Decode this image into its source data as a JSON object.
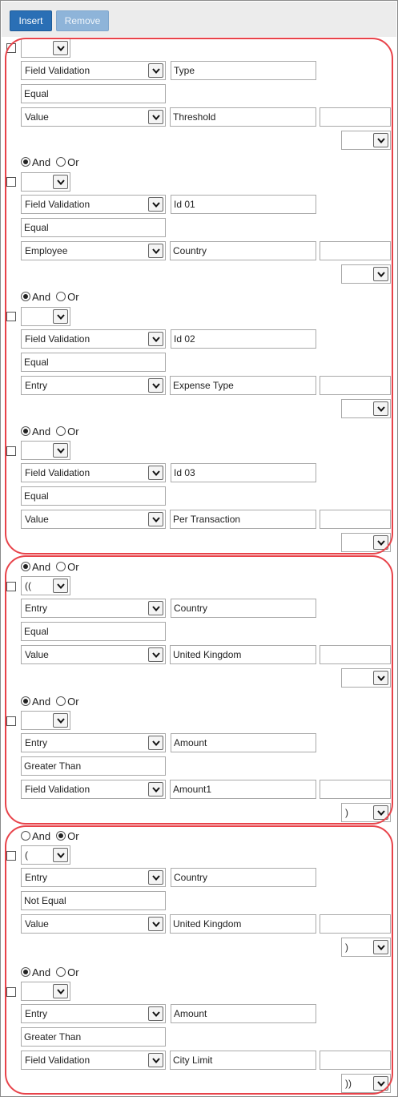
{
  "toolbar": {
    "insert_label": "Insert",
    "remove_label": "Remove"
  },
  "conditions": [
    {
      "show_andor": false,
      "andor": "",
      "paren_open": "",
      "source": "Field Validation",
      "field": "Type",
      "operator": "Equal",
      "value_source": "Value",
      "value": "Threshold",
      "value2": "",
      "paren_close": ""
    },
    {
      "show_andor": true,
      "andor": "And",
      "paren_open": "",
      "source": "Field Validation",
      "field": "Id 01",
      "operator": "Equal",
      "value_source": "Employee",
      "value": "Country",
      "value2": "",
      "paren_close": ""
    },
    {
      "show_andor": true,
      "andor": "And",
      "paren_open": "",
      "source": "Field Validation",
      "field": "Id 02",
      "operator": "Equal",
      "value_source": "Entry",
      "value": "Expense Type",
      "value2": "",
      "paren_close": ""
    },
    {
      "show_andor": true,
      "andor": "And",
      "paren_open": "",
      "source": "Field Validation",
      "field": "Id 03",
      "operator": "Equal",
      "value_source": "Value",
      "value": "Per Transaction",
      "value2": "",
      "paren_close": ""
    },
    {
      "show_andor": true,
      "andor": "And",
      "paren_open": "((",
      "source": "Entry",
      "field": "Country",
      "operator": "Equal",
      "value_source": "Value",
      "value": "United Kingdom",
      "value2": "",
      "paren_close": ""
    },
    {
      "show_andor": true,
      "andor": "And",
      "paren_open": "",
      "source": "Entry",
      "field": "Amount",
      "operator": "Greater Than",
      "value_source": "Field Validation",
      "value": "Amount1",
      "value2": "",
      "paren_close": ")"
    },
    {
      "show_andor": true,
      "andor": "Or",
      "paren_open": "(",
      "source": "Entry",
      "field": "Country",
      "operator": "Not Equal",
      "value_source": "Value",
      "value": "United Kingdom",
      "value2": "",
      "paren_close": ")"
    },
    {
      "show_andor": true,
      "andor": "And",
      "paren_open": "",
      "source": "Entry",
      "field": "Amount",
      "operator": "Greater Than",
      "value_source": "Field Validation",
      "value": "City Limit",
      "value2": "",
      "paren_close": "))"
    }
  ],
  "radio_labels": {
    "and": "And",
    "or": "Or"
  },
  "colors": {
    "group_border": "#e8434a",
    "insert_bg": "#2a6fb5",
    "remove_bg": "#8eb4d9"
  },
  "icons": {
    "dropdown": "chevron-down-icon"
  }
}
